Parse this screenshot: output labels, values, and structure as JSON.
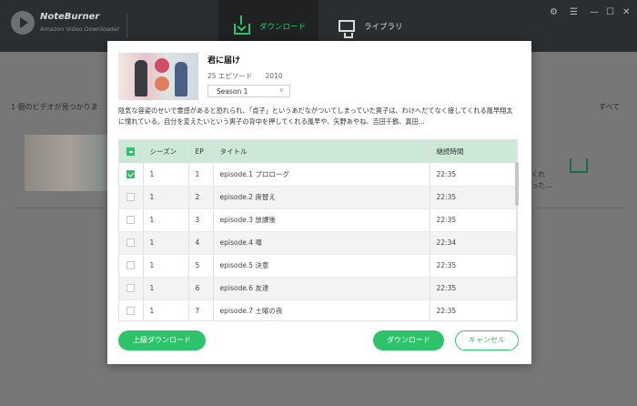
{
  "app": {
    "name": "NoteBurner",
    "subtitle": "Amazon Video Downloader"
  },
  "tabs": [
    {
      "label": "ダウンロード",
      "active": true
    },
    {
      "label": "ライブラリ",
      "active": false
    }
  ],
  "window_controls": [
    "gear-icon",
    "menu-icon",
    "minimize-icon",
    "maximize-icon",
    "close-icon"
  ],
  "background": {
    "found_text": "1 個のビデオが見つかりま",
    "all_label": "すべて",
    "side_text_line1": "くれ",
    "side_text_line2": "った..."
  },
  "dialog": {
    "title": "君に届け",
    "episodes_count": "25 エピソード",
    "year": "2010",
    "season_selected": "Season 1",
    "description": "陰気な容姿のせいで霊感があると恐れられ、「貞子」というあだながついてしまっていた爽子は、わけへだてなく接してくれる風早翔太に憧れている。自分を変えたいという爽子の背中を押してくれる風早や、矢野あやね、吉田千鶴、真田...",
    "columns": {
      "season": "シーズン",
      "ep": "EP",
      "title": "タイトル",
      "duration": "継続時間"
    },
    "episodes": [
      {
        "checked": true,
        "season": "1",
        "ep": "1",
        "title": "episode.1 プロローグ",
        "duration": "22:35"
      },
      {
        "checked": false,
        "season": "1",
        "ep": "2",
        "title": "episode.2 席替え",
        "duration": "22:35"
      },
      {
        "checked": false,
        "season": "1",
        "ep": "3",
        "title": "episode.3 放課後",
        "duration": "22:35"
      },
      {
        "checked": false,
        "season": "1",
        "ep": "4",
        "title": "episode.4 噂",
        "duration": "22:34"
      },
      {
        "checked": false,
        "season": "1",
        "ep": "5",
        "title": "episode.5 決意",
        "duration": "22:35"
      },
      {
        "checked": false,
        "season": "1",
        "ep": "6",
        "title": "episode.6 友達",
        "duration": "22:35"
      },
      {
        "checked": false,
        "season": "1",
        "ep": "7",
        "title": "episode.7 土曜の夜",
        "duration": "22:35"
      }
    ],
    "buttons": {
      "advanced": "上級ダウンロード",
      "download": "ダウンロード",
      "cancel": "キャンセル"
    }
  },
  "colors": {
    "accent": "#2cc36b",
    "header_bg": "#2b2e31",
    "table_header": "#cde8d7"
  }
}
